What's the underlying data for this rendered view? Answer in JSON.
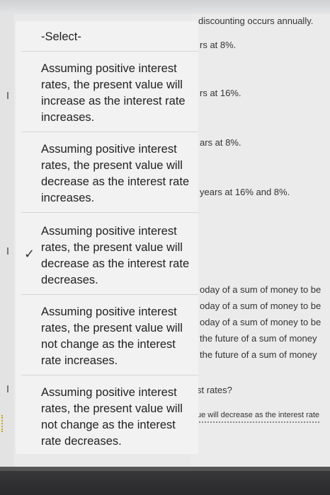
{
  "header": {
    "title_fragment": "discounting occurs annually."
  },
  "background_lines": [
    "discounting occurs annually.",
    "rs at 8%.",
    "rs at 16%.",
    "ars at 8%.",
    "years at 16% and 8%.",
    "oday of a sum of money to be",
    "oday of a sum of money to be",
    "oday of a sum of money to be",
    "the future of a sum of money",
    "the future of a sum of money",
    "st rates?",
    "ue will decrease as the interest rate"
  ],
  "dropdown": {
    "placeholder": "-Select-",
    "options": [
      "Assuming positive interest rates, the present value will increase as the interest rate increases.",
      "Assuming positive interest rates, the present value will decrease as the interest rate increases.",
      "Assuming positive interest rates, the present value will decrease as the interest rate decreases.",
      "Assuming positive interest rates, the present value will not change as the interest rate increases.",
      "Assuming positive interest rates, the present value will not change as the interest rate decreases."
    ],
    "selected_index": 2
  },
  "icons": {
    "selected": "checkmark-icon"
  },
  "colors": {
    "dropdown_bg": "#f2f2f3",
    "page_bg": "#ebebec"
  }
}
